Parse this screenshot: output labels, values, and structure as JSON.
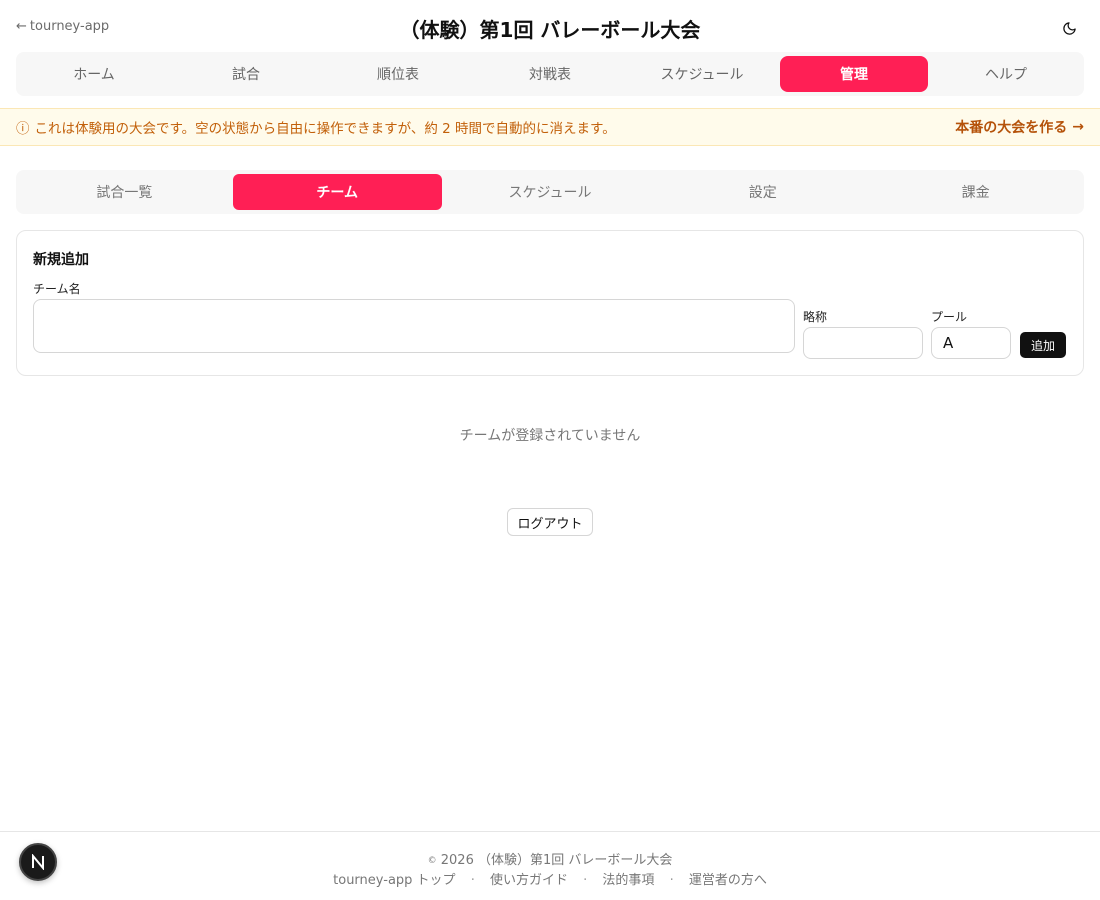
{
  "header": {
    "back_label": "tourney-app",
    "title": "（体験）第1回 バレーボール大会",
    "theme_icon": "moon-icon"
  },
  "main_nav": {
    "tabs": [
      {
        "label": "ホーム",
        "active": false
      },
      {
        "label": "試合",
        "active": false
      },
      {
        "label": "順位表",
        "active": false
      },
      {
        "label": "対戦表",
        "active": false
      },
      {
        "label": "スケジュール",
        "active": false
      },
      {
        "label": "管理",
        "active": true
      },
      {
        "label": "ヘルプ",
        "active": false
      }
    ]
  },
  "banner": {
    "icon": "ⓘ",
    "message": "これは体験用の大会です。空の状態から自由に操作できますが、約 2 時間で自動的に消えます。",
    "cta_label": "本番の大会を作る",
    "cta_arrow": "→"
  },
  "sub_nav": {
    "tabs": [
      {
        "label": "試合一覧",
        "active": false
      },
      {
        "label": "チーム",
        "active": true
      },
      {
        "label": "スケジュール",
        "active": false
      },
      {
        "label": "設定",
        "active": false
      },
      {
        "label": "課金",
        "active": false
      }
    ]
  },
  "form": {
    "title": "新規追加",
    "team_name_label": "チーム名",
    "team_name_value": "",
    "abbr_label": "略称",
    "abbr_value": "",
    "pool_label": "プール",
    "pool_value": "A",
    "add_label": "追加"
  },
  "empty_message": "チームが登録されていません",
  "logout_label": "ログアウト",
  "footer": {
    "copyright_symbol": "©",
    "copyright_text": "2026 （体験）第1回 バレーボール大会",
    "links": [
      "tourney-app トップ",
      "使い方ガイド",
      "法的事項",
      "運営者の方へ"
    ],
    "separator": "·"
  },
  "badge": {
    "letter": "N"
  },
  "colors": {
    "accent": "#ff1f55",
    "banner_bg": "#fffbeb",
    "banner_text": "#c2600a"
  }
}
